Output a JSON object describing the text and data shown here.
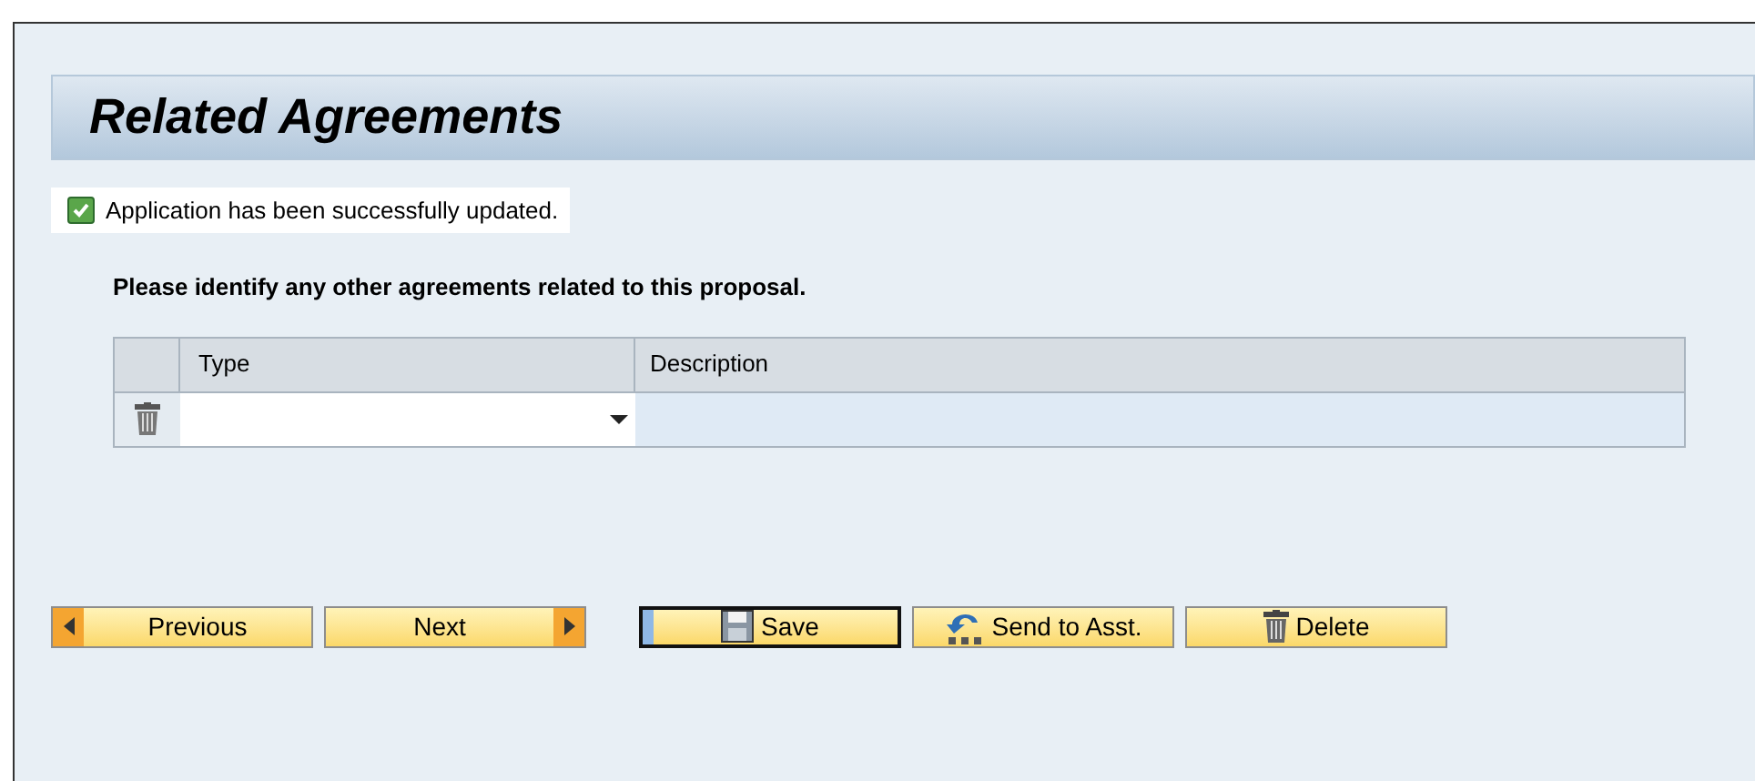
{
  "header": {
    "title": "Related Agreements"
  },
  "message": {
    "text": "Application has been successfully updated.",
    "checked": true
  },
  "instruction": "Please identify any other agreements related to this proposal.",
  "table": {
    "columns": [
      "Type",
      "Description"
    ],
    "rows": [
      {
        "kind": "input"
      }
    ]
  },
  "buttons": [
    {
      "label": "Previous",
      "kind": "previous",
      "focused": false
    },
    {
      "label": "Next",
      "kind": "next",
      "focused": false
    },
    {
      "label": "Save",
      "kind": "save",
      "focused": true
    },
    {
      "label": "Send to Asst.",
      "kind": "send",
      "focused": false
    },
    {
      "label": "Delete",
      "kind": "delete",
      "focused": false
    }
  ]
}
